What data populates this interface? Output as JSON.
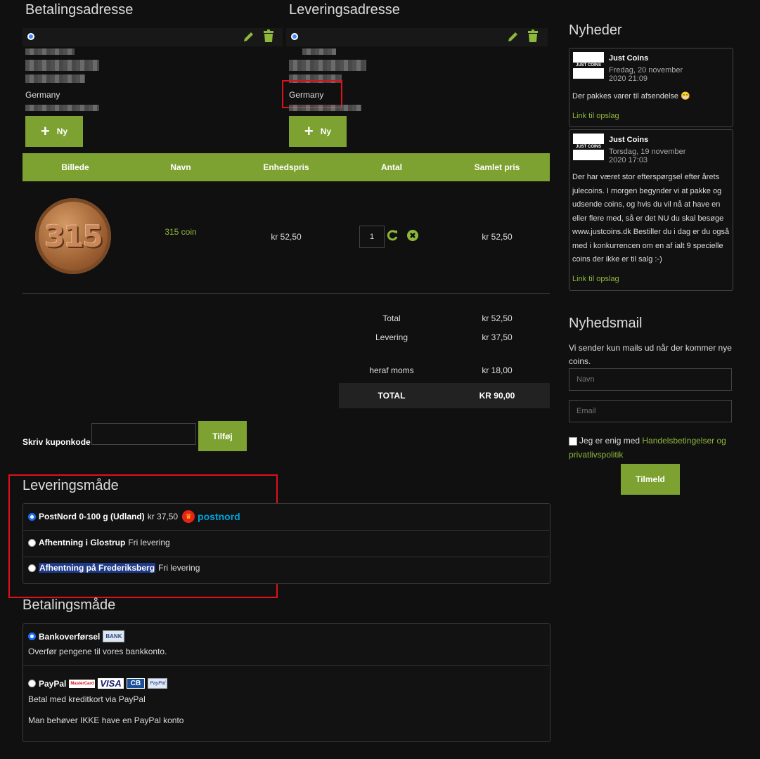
{
  "billing": {
    "title": "Betalingsadresse",
    "country": "Germany",
    "new_label": "Ny"
  },
  "shipping": {
    "title": "Leveringsadresse",
    "country": "Germany",
    "new_label": "Ny"
  },
  "cart": {
    "headers": [
      "Billede",
      "Navn",
      "Enhedspris",
      "Antal",
      "Samlet pris"
    ],
    "item": {
      "coin_text": "315",
      "name": "315 coin",
      "unit_price": "kr 52,50",
      "qty": "1",
      "total": "kr 52,50"
    }
  },
  "totals": {
    "total_label": "Total",
    "total_value": "kr 52,50",
    "delivery_label": "Levering",
    "delivery_value": "kr 37,50",
    "vat_label": "heraf moms",
    "vat_value": "kr 18,00",
    "grand_label": "TOTAL",
    "grand_value": "KR 90,00"
  },
  "coupon": {
    "label": "Skriv kuponkode",
    "button": "Tilføj"
  },
  "delivery": {
    "title": "Leveringsmåde",
    "options": [
      {
        "name": "PostNord 0-100 g (Udland)",
        "price": "kr 37,50",
        "logo": "postnord"
      },
      {
        "name": "Afhentning i Glostrup",
        "price": "Fri levering"
      },
      {
        "name": "Afhentning på Frederiksberg",
        "price": "Fri levering"
      }
    ]
  },
  "payment": {
    "title": "Betalingsmåde",
    "options": [
      {
        "name": "Bankoverførsel",
        "badge": "BANK",
        "desc": "Overfør pengene til vores bankkonto."
      },
      {
        "name": "PayPal",
        "cards": [
          "MasterCard",
          "VISA",
          "CB",
          "PayPal"
        ],
        "desc": "Betal med kreditkort via PayPal",
        "desc2": "Man behøver IKKE have en PayPal konto"
      }
    ]
  },
  "news": {
    "title": "Nyheder",
    "posts": [
      {
        "author": "Just Coins",
        "logo": "JUST COINS",
        "date": "Fredag, 20 november",
        "time": "2020 21:09",
        "text": "Der pakkes varer til afsendelse 😁",
        "link": "Link til opslag"
      },
      {
        "author": "Just Coins",
        "logo": "JUST COINS",
        "date": "Torsdag, 19 november",
        "time": "2020 17:03",
        "text": "Der har været stor efterspørgsel efter årets julecoins. I morgen begynder vi at pakke og udsende coins, og hvis du vil nå at have en eller flere med, så er det NU du skal besøge www.justcoins.dk Bestiller du i dag er du også med i konkurrencen om en af ialt 9 specielle coins der ikke er til salg :-)",
        "link": "Link til opslag"
      }
    ]
  },
  "newsletter": {
    "title": "Nyhedsmail",
    "desc": "Vi sender kun mails ud når der kommer nye coins.",
    "name_placeholder": "Navn",
    "email_placeholder": "Email",
    "agree_text": "Jeg er enig med ",
    "agree_link": "Handelsbetingelser og privatlivspolitik",
    "button": "Tilmeld"
  },
  "colors": {
    "accent": "#7ea231",
    "highlight": "#e0101a",
    "radio": "#1a6dff"
  }
}
